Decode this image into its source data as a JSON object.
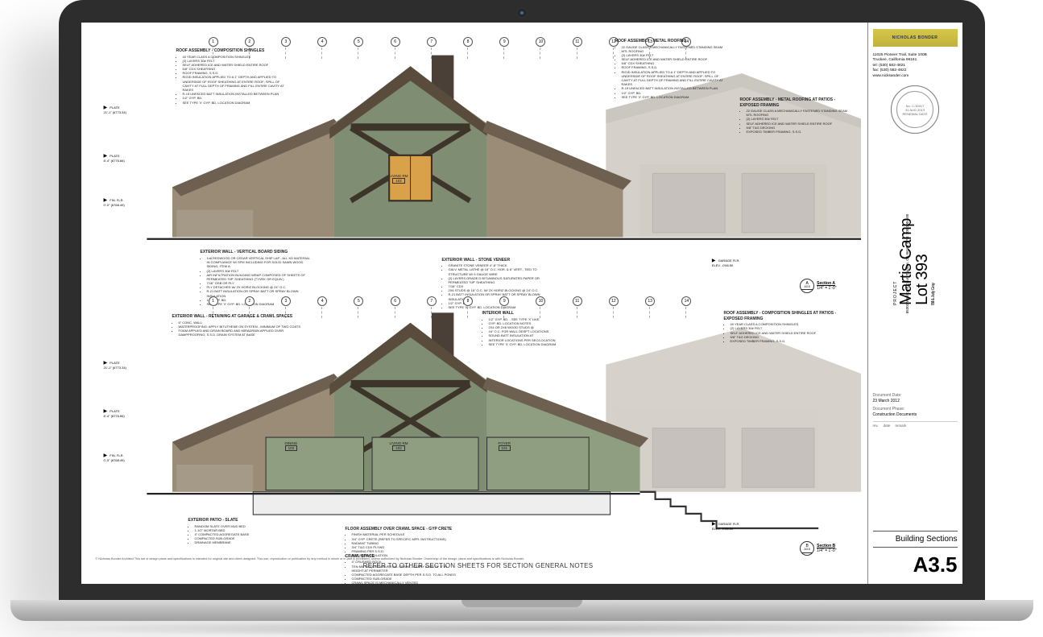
{
  "firm": {
    "logo_text": "NICHOLAS BONDER",
    "addr_line1": "11025 Pioneer Trail, Suite 100B",
    "addr_line2": "Truckee, California 96161",
    "tel": "tel: (530) 582-4821",
    "fax": "fax: (530) 582-4822",
    "web": "www.nicksander.com"
  },
  "stamp": {
    "top": "LICENSED ARCHITECT",
    "no": "No. C-30417",
    "date": "31 AUG 2013",
    "renewal": "RENEWAL DATE",
    "state": "STATE OF CALIFORNIA"
  },
  "project": {
    "label": "PROJECT",
    "line1": "Martis Camp",
    "line2": "Lot 393",
    "client": "Bill & Judy Gray",
    "addr1": "85302 Wellscroft Court",
    "addr2": "Truckee, CA 96161",
    "apn": "APN: 100-100-100"
  },
  "doc": {
    "date_label": "Document Date:",
    "date_value": "23 March 2012",
    "phase_label": "Document Phase:",
    "phase_value": "Construction Documents",
    "rev": "rev.",
    "revdate": "date",
    "revremark": "remark"
  },
  "sheet": {
    "title": "Building Sections",
    "number": "A3.5"
  },
  "grid_numbers": [
    "1",
    "2",
    "3",
    "4",
    "5",
    "6",
    "7",
    "8",
    "9",
    "10",
    "11",
    "12",
    "13",
    "14"
  ],
  "sections": {
    "a": {
      "letter": "A",
      "sheet": "A3.5",
      "label": "Section A",
      "scale": "1/4\" = 1'-0\""
    },
    "b": {
      "letter": "B",
      "sheet": "A3.5",
      "label": "Section B",
      "scale": "1/4\" = 1'-0\""
    }
  },
  "bottom_note": "REFER TO OTHER SECTION SHEETS FOR SECTION GENERAL NOTES",
  "copyright": "© Nicholas Bonder Architect   This set of design plans and specifications is intended for original site and client designed. This use, reproduction or publication by any method in whole or in part is prohibited, unless authorized by Nicholas Bonder. Ownership of the design, plans and specifications is with Nicholas Bonder.",
  "annotations": {
    "roof_comp": {
      "title": "ROOF ASSEMBLY - COMPOSITION SHINGLES",
      "items": [
        "40 YEAR CLASS A COMPOSITION SHINGLES",
        "(2) LAYERS 30# FELT",
        "SELF ADHERED ICE AND WATER SHIELD ENTIRE ROOF",
        "5/8\" CDX SHEATHING",
        "ROOF FRAMING, S.S.D.",
        "RIGID INSULATION APPLIED TO A 1\" DEPTH AND APPLIED TO UNDERSIDE OF ROOF SHEATHING AT ENTIRE ROOF; SPILL OF CAVITY AT FULL DEPTH OF FRAMING AND FILL ENTIRE CAVITY AT RAKES",
        "R-19 UNFACED BATT INSULATION INSTALLED BETWEEN PLAN",
        "1/2\" GYP. BD.",
        "SEE TYPE 'X' GYP. BD. LOCATION DIAGRAM"
      ]
    },
    "roof_metal": {
      "title": "ROOF ASSEMBLY - METAL ROOFING",
      "items": [
        "22 GAUGE CLASS A MECHANICALLY FASTENED STANDING SEAM MTL ROOFING",
        "(2) LAYERS 30# FELT",
        "SELF ADHERED ICE AND WATER SHIELD ENTIRE ROOF",
        "5/8\" CDX SHEATHING",
        "ROOF FRAMING, S.S.D.",
        "RIGID INSULATION APPLIED TO A 1\" DEPTH AND APPLIED TO UNDERSIDE OF ROOF SHEATHING AT ENTIRE ROOF; SPILL OF CAVITY AT FULL DEPTH OF FRAMING AND FILL ENTIRE CAVITY AT RAKES",
        "R-19 UNFACED BATT INSULATION INSTALLED BETWEEN PLAN",
        "1/2\" GYP. BD.",
        "SEE TYPE 'X' GYP. BD. LOCATION DIAGRAM"
      ]
    },
    "roof_metal_patio": {
      "title": "ROOF ASSEMBLY - METAL ROOFING AT PATIOS - EXPOSED FRAMING",
      "items": [
        "22 GAUGE CLASS A MECHANICALLY FASTENED STANDING SEAM MTL ROOFING",
        "(2) LAYERS 30# FELT",
        "SELF ADHERED ICE AND WATER SHIELD ENTIRE ROOF",
        "5/8\" T&G DECKING",
        "EXPOSED TIMBER FRAMING, S.S.D."
      ]
    },
    "roof_comp_patio": {
      "title": "ROOF ASSEMBLY - COMPOSITION SHINGLES AT PATIOS - EXPOSED FRAMING",
      "items": [
        "40 YEAR CLASS A COMPOSITION SHINGLES",
        "(2) LAYERS 30# FELT",
        "SELF ADHERED ICE AND WATER SHIELD ENTIRE ROOF",
        "5/8\" T&G DECKING",
        "EXPOSED TIMBER FRAMING, S.S.D."
      ]
    },
    "ext_wall_vbs": {
      "title": "EXTERIOR WALL - VERTICAL BOARD SIDING",
      "items": [
        "1x8 REDWOOD OR CEDAR VERTICAL SHIP LAP - ALL KD MATERIAL IN COMPLIANCE W/ SFM INCLUDING FOR SOLID SAWN WOOD SIDING, ITEM A",
        "(2) LAYERS 30# FELT",
        "AIR INFILTRATION BUILDING WRAP COMPOSED OF SHEETS OF PERMEATED 'SIP' SHEATHING (TYVEK OR EQUIV.)",
        "7/16\" OSB OR PLY",
        "PLY DETACHED W/ 2X HORIZ BLOCKING @ 24\" O.C.",
        "R-21 BATT INSULATION OR SPRAY BATT OR SPRAY BLOWN INSULATION",
        "1/2\" GYP. BD.",
        "SEE TYPE 'X' GYP. BD. LOCATION DIAGRAM"
      ]
    },
    "ext_wall_stone": {
      "title": "EXTERIOR WALL - STONE VENEER",
      "items": [
        "GRANITE STONE VENEER 4\"-8\" THICK",
        "GALV. METAL LATHE @ 16\" O.C. HOR. & 6\" VERT., TIED TO STRUCTURE W/ 9 GAUGE WIRE",
        "(2) LAYERS GRADE D BITUMINOUS SATURATED PAPER OR PERMEATED 'SIP' SHEATHING",
        "7/16\" CDX",
        "2X6 STUDS @ 16\" O.C. W/ 2X HORIZ BLOCKING @ 24\" O.C.",
        "R-21 BATT INSULATION OR SPRAY BATT OR SPRAY BLOWN INSULATION",
        "1/2\" GYP. BD.",
        "SEE TYPE 'X' GYP. BD. LOCATION DIAGRAM"
      ]
    },
    "ext_wall_retain": {
      "title": "EXTERIOR WALL - RETAINING AT GARAGE & CRAWL SPACES",
      "items": [
        "6\" CONC. WALL",
        "WATERPROOFING: APPLY BITUTHENE ON SYSTEM - MINIMUM OF TWO COATS",
        "FOAM APPLIED AND DRAIN BOARD AND MIRADRAIN APPLIED OVER DAMPPROOFING; S.S.D. DRAIN SYSTEM AT BASE"
      ]
    },
    "int_wall": {
      "title": "INTERIOR WALL",
      "items": [
        "1/2\" GYP. BD. - SEE TYPE 'X' LIKE",
        "GYP. BD. LOCATION NOTES",
        "2X4 OR 2X6 WOOD STUDS @",
        "16\" O.C. FOR WALL DESPT LOCATIONS",
        "SOUND BATT INSULATION AT",
        "INTERIOR LOCATIONS PER SEC/LOCATION",
        "SEE TYPE 'X' GYP. BD. LOCATION DIAGRAM"
      ]
    },
    "ext_patio": {
      "title": "EXTERIOR PATIO - SLATE",
      "items": [
        "RANDOM SLATE OVER MUD BED",
        "1-1/2\" MORTAR BED",
        "4\" COMPACTED AGGREGATE BASE",
        "COMPACTED SUB-GRADE",
        "DRAINAGE MEMBRANE"
      ]
    },
    "floor_crawl": {
      "title": "FLOOR ASSEMBLY OVER CRAWL SPACE - GYP CRETE",
      "items": [
        "FINISH MATERIAL PER SCHEDULE",
        "3/4\" GYP. CRETE (REFER TO SPECIFIC MFR. INSTRUCTIONS)",
        "RADIANT TUBING",
        "3/4\" T&G CDX PLYWD",
        "FRAMING PER S.S.D.",
        "R-30 BATT INSULATION"
      ]
    },
    "crawl": {
      "title": "CRAWL SPACE",
      "items": [
        "4\" CRUSHED ROCK",
        "TEN MIL VISQUEEN OVER ALL CRAWL - CARRY A MIN OF 8\" IN HEIGHT AT PERIMETER",
        "COMPACTED AGGREGATE BASE DEPTH PER S.S.D. TO ALL PONDS",
        "COMPACTED SUB-GRADE",
        "CRAWL SPACE IS MECHANICALLY VENTED"
      ]
    }
  },
  "plates": {
    "top_a": {
      "l1": "PLATE",
      "l2": "21'-1\" (6773.34)"
    },
    "mid_a": {
      "l1": "PLATE",
      "l2": "8'-4\" (6776.66)"
    },
    "fin_a": {
      "l1": "FIN. FLR.",
      "l2": "0'-0\" (6768.49)"
    },
    "garage": {
      "l1": "GARAGE FLR.",
      "l2": "ELEV. -0'66.50"
    }
  },
  "rooms": {
    "living_top": {
      "name": "LIVING RM",
      "num": "102"
    },
    "dining": {
      "name": "DINING",
      "num": "103"
    },
    "living_bot": {
      "name": "LIVING RM",
      "num": "102"
    },
    "foyer": {
      "name": "FOYER",
      "num": "101"
    }
  }
}
